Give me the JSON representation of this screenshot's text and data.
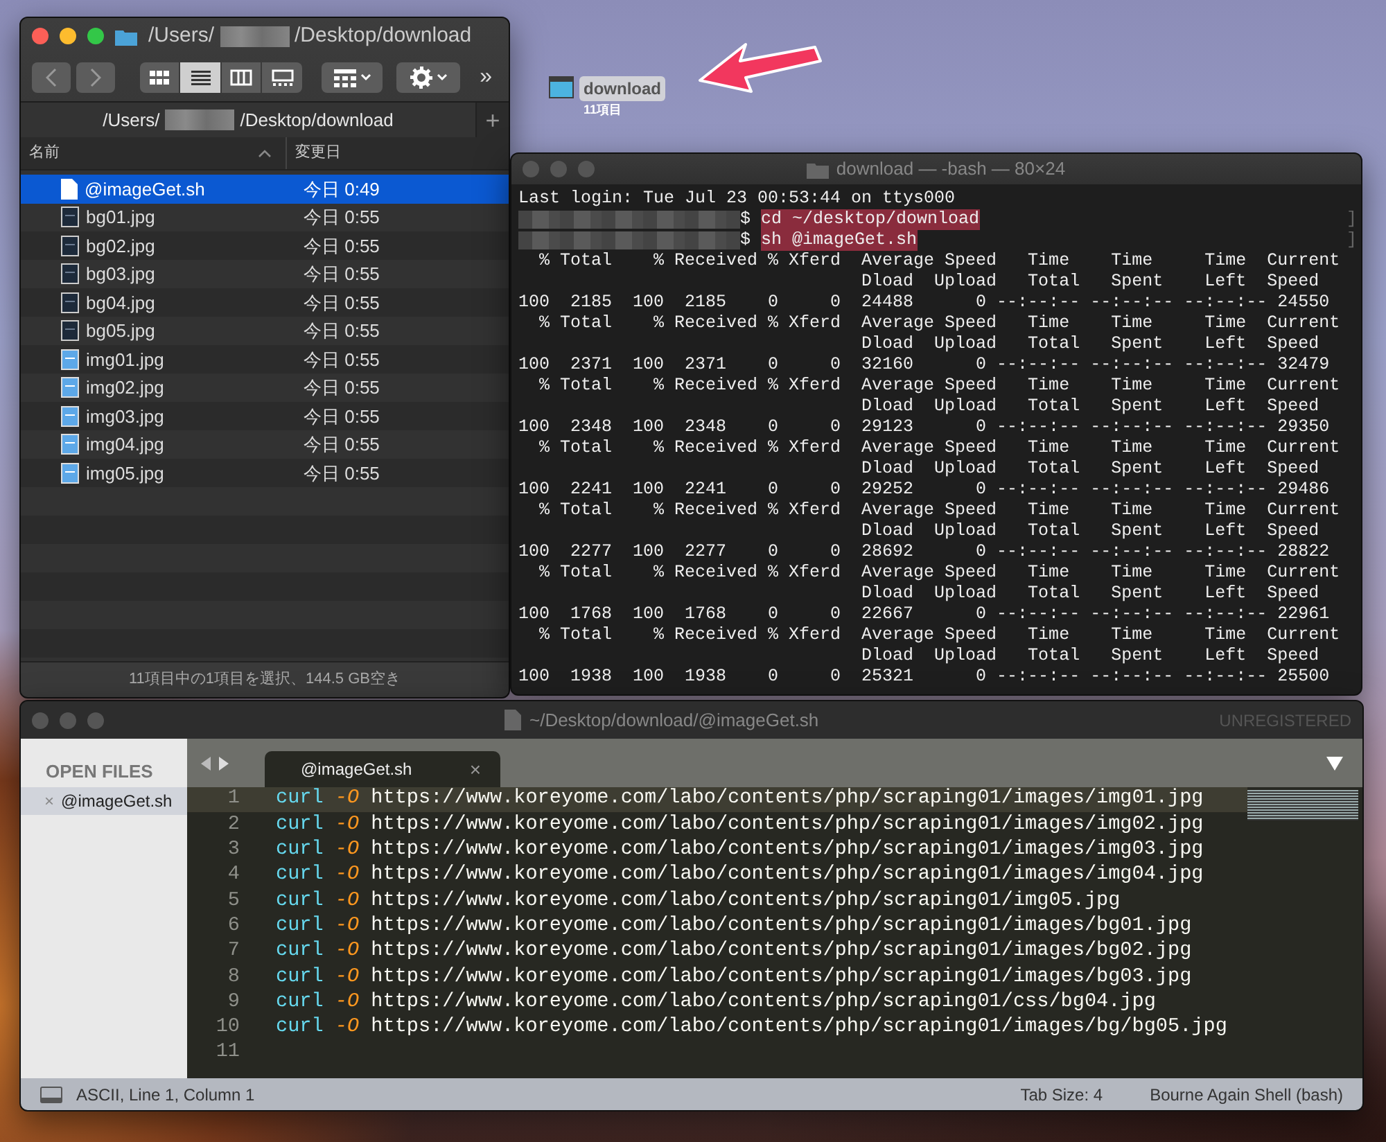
{
  "desktop_icon": {
    "label": "download",
    "subtitle": "11項目",
    "selected": true
  },
  "finder": {
    "title": [
      {
        "kind": "text",
        "text": "/Users/"
      },
      {
        "kind": "redacted"
      },
      {
        "kind": "text",
        "text": "/Desktop/download"
      }
    ],
    "views": [
      {
        "kind": "icons",
        "selected": false
      },
      {
        "kind": "list",
        "selected": true
      },
      {
        "kind": "columns",
        "selected": false
      },
      {
        "kind": "gallery",
        "selected": false
      }
    ],
    "more": "»",
    "path_tab": [
      {
        "kind": "text",
        "text": "/Users/"
      },
      {
        "kind": "redacted"
      },
      {
        "kind": "text",
        "text": "/Desktop/download"
      }
    ],
    "add_tab": "+",
    "columns": [
      {
        "label": "名前",
        "sorted": true
      },
      {
        "label": "変更日",
        "sorted": false
      }
    ],
    "files": [
      {
        "name": "@imageGet.sh",
        "date": "今日 0:49",
        "kind": "script",
        "selected": true
      },
      {
        "name": "bg01.jpg",
        "date": "今日 0:55",
        "kind": "dark",
        "selected": false
      },
      {
        "name": "bg02.jpg",
        "date": "今日 0:55",
        "kind": "dark",
        "selected": false
      },
      {
        "name": "bg03.jpg",
        "date": "今日 0:55",
        "kind": "dark",
        "selected": false
      },
      {
        "name": "bg04.jpg",
        "date": "今日 0:55",
        "kind": "dark",
        "selected": false
      },
      {
        "name": "bg05.jpg",
        "date": "今日 0:55",
        "kind": "dark",
        "selected": false
      },
      {
        "name": "img01.jpg",
        "date": "今日 0:55",
        "kind": "light",
        "selected": false
      },
      {
        "name": "img02.jpg",
        "date": "今日 0:55",
        "kind": "light",
        "selected": false
      },
      {
        "name": "img03.jpg",
        "date": "今日 0:55",
        "kind": "light",
        "selected": false
      },
      {
        "name": "img04.jpg",
        "date": "今日 0:55",
        "kind": "light",
        "selected": false
      },
      {
        "name": "img05.jpg",
        "date": "今日 0:55",
        "kind": "light",
        "selected": false
      }
    ],
    "status_bar": "11項目中の1項目を選択、144.5 GB空き"
  },
  "terminal": {
    "title": "download — -bash — 80×24",
    "lines": [
      {
        "kind": "text",
        "text": "Last login: Tue Jul 23 00:53:44 on ttys000"
      },
      {
        "kind": "prompt",
        "symbol": "$",
        "command": "cd ~/desktop/download",
        "mark": "]"
      },
      {
        "kind": "prompt",
        "symbol": "$",
        "command": "sh @imageGet.sh",
        "mark": "]"
      },
      {
        "kind": "text",
        "text": "  % Total    % Received % Xferd  Average Speed   Time    Time     Time  Current"
      },
      {
        "kind": "text",
        "text": "                                 Dload  Upload   Total   Spent    Left  Speed"
      },
      {
        "kind": "text",
        "text": "100  2185  100  2185    0     0  24488      0 --:--:-- --:--:-- --:--:-- 24550"
      },
      {
        "kind": "text",
        "text": "  % Total    % Received % Xferd  Average Speed   Time    Time     Time  Current"
      },
      {
        "kind": "text",
        "text": "                                 Dload  Upload   Total   Spent    Left  Speed"
      },
      {
        "kind": "text",
        "text": "100  2371  100  2371    0     0  32160      0 --:--:-- --:--:-- --:--:-- 32479"
      },
      {
        "kind": "text",
        "text": "  % Total    % Received % Xferd  Average Speed   Time    Time     Time  Current"
      },
      {
        "kind": "text",
        "text": "                                 Dload  Upload   Total   Spent    Left  Speed"
      },
      {
        "kind": "text",
        "text": "100  2348  100  2348    0     0  29123      0 --:--:-- --:--:-- --:--:-- 29350"
      },
      {
        "kind": "text",
        "text": "  % Total    % Received % Xferd  Average Speed   Time    Time     Time  Current"
      },
      {
        "kind": "text",
        "text": "                                 Dload  Upload   Total   Spent    Left  Speed"
      },
      {
        "kind": "text",
        "text": "100  2241  100  2241    0     0  29252      0 --:--:-- --:--:-- --:--:-- 29486"
      },
      {
        "kind": "text",
        "text": "  % Total    % Received % Xferd  Average Speed   Time    Time     Time  Current"
      },
      {
        "kind": "text",
        "text": "                                 Dload  Upload   Total   Spent    Left  Speed"
      },
      {
        "kind": "text",
        "text": "100  2277  100  2277    0     0  28692      0 --:--:-- --:--:-- --:--:-- 28822"
      },
      {
        "kind": "text",
        "text": "  % Total    % Received % Xferd  Average Speed   Time    Time     Time  Current"
      },
      {
        "kind": "text",
        "text": "                                 Dload  Upload   Total   Spent    Left  Speed"
      },
      {
        "kind": "text",
        "text": "100  1768  100  1768    0     0  22667      0 --:--:-- --:--:-- --:--:-- 22961"
      },
      {
        "kind": "text",
        "text": "  % Total    % Received % Xferd  Average Speed   Time    Time     Time  Current"
      },
      {
        "kind": "text",
        "text": "                                 Dload  Upload   Total   Spent    Left  Speed"
      },
      {
        "kind": "text",
        "text": "100  1938  100  1938    0     0  25321      0 --:--:-- --:--:-- --:--:-- 25500"
      }
    ]
  },
  "editor": {
    "title": "~/Desktop/download/@imageGet.sh",
    "license": "UNREGISTERED",
    "sidebar": {
      "heading": "OPEN FILES",
      "files": [
        {
          "close": "×",
          "name": "@imageGet.sh",
          "selected": true
        }
      ]
    },
    "tabs": [
      {
        "label": "@imageGet.sh",
        "close": "×",
        "selected": true
      }
    ],
    "lines": [
      {
        "number": "1",
        "current": true,
        "command": "curl",
        "flag": "-O",
        "url": "https://www.koreyome.com/labo/contents/php/scraping01/images/img01.jpg"
      },
      {
        "number": "2",
        "current": false,
        "command": "curl",
        "flag": "-O",
        "url": "https://www.koreyome.com/labo/contents/php/scraping01/images/img02.jpg"
      },
      {
        "number": "3",
        "current": false,
        "command": "curl",
        "flag": "-O",
        "url": "https://www.koreyome.com/labo/contents/php/scraping01/images/img03.jpg"
      },
      {
        "number": "4",
        "current": false,
        "command": "curl",
        "flag": "-O",
        "url": "https://www.koreyome.com/labo/contents/php/scraping01/images/img04.jpg"
      },
      {
        "number": "5",
        "current": false,
        "command": "curl",
        "flag": "-O",
        "url": "https://www.koreyome.com/labo/contents/php/scraping01/img05.jpg"
      },
      {
        "number": "6",
        "current": false,
        "command": "curl",
        "flag": "-O",
        "url": "https://www.koreyome.com/labo/contents/php/scraping01/images/bg01.jpg"
      },
      {
        "number": "7",
        "current": false,
        "command": "curl",
        "flag": "-O",
        "url": "https://www.koreyome.com/labo/contents/php/scraping01/images/bg02.jpg"
      },
      {
        "number": "8",
        "current": false,
        "command": "curl",
        "flag": "-O",
        "url": "https://www.koreyome.com/labo/contents/php/scraping01/images/bg03.jpg"
      },
      {
        "number": "9",
        "current": false,
        "command": "curl",
        "flag": "-O",
        "url": "https://www.koreyome.com/labo/contents/php/scraping01/css/bg04.jpg"
      },
      {
        "number": "10",
        "current": false,
        "command": "curl",
        "flag": "-O",
        "url": "https://www.koreyome.com/labo/contents/php/scraping01/images/bg/bg05.jpg"
      },
      {
        "number": "11",
        "current": false
      }
    ],
    "status_bar": {
      "position": "ASCII, Line 1, Column 1",
      "tab_size": "Tab Size: 4",
      "syntax": "Bourne Again Shell (bash)"
    }
  }
}
